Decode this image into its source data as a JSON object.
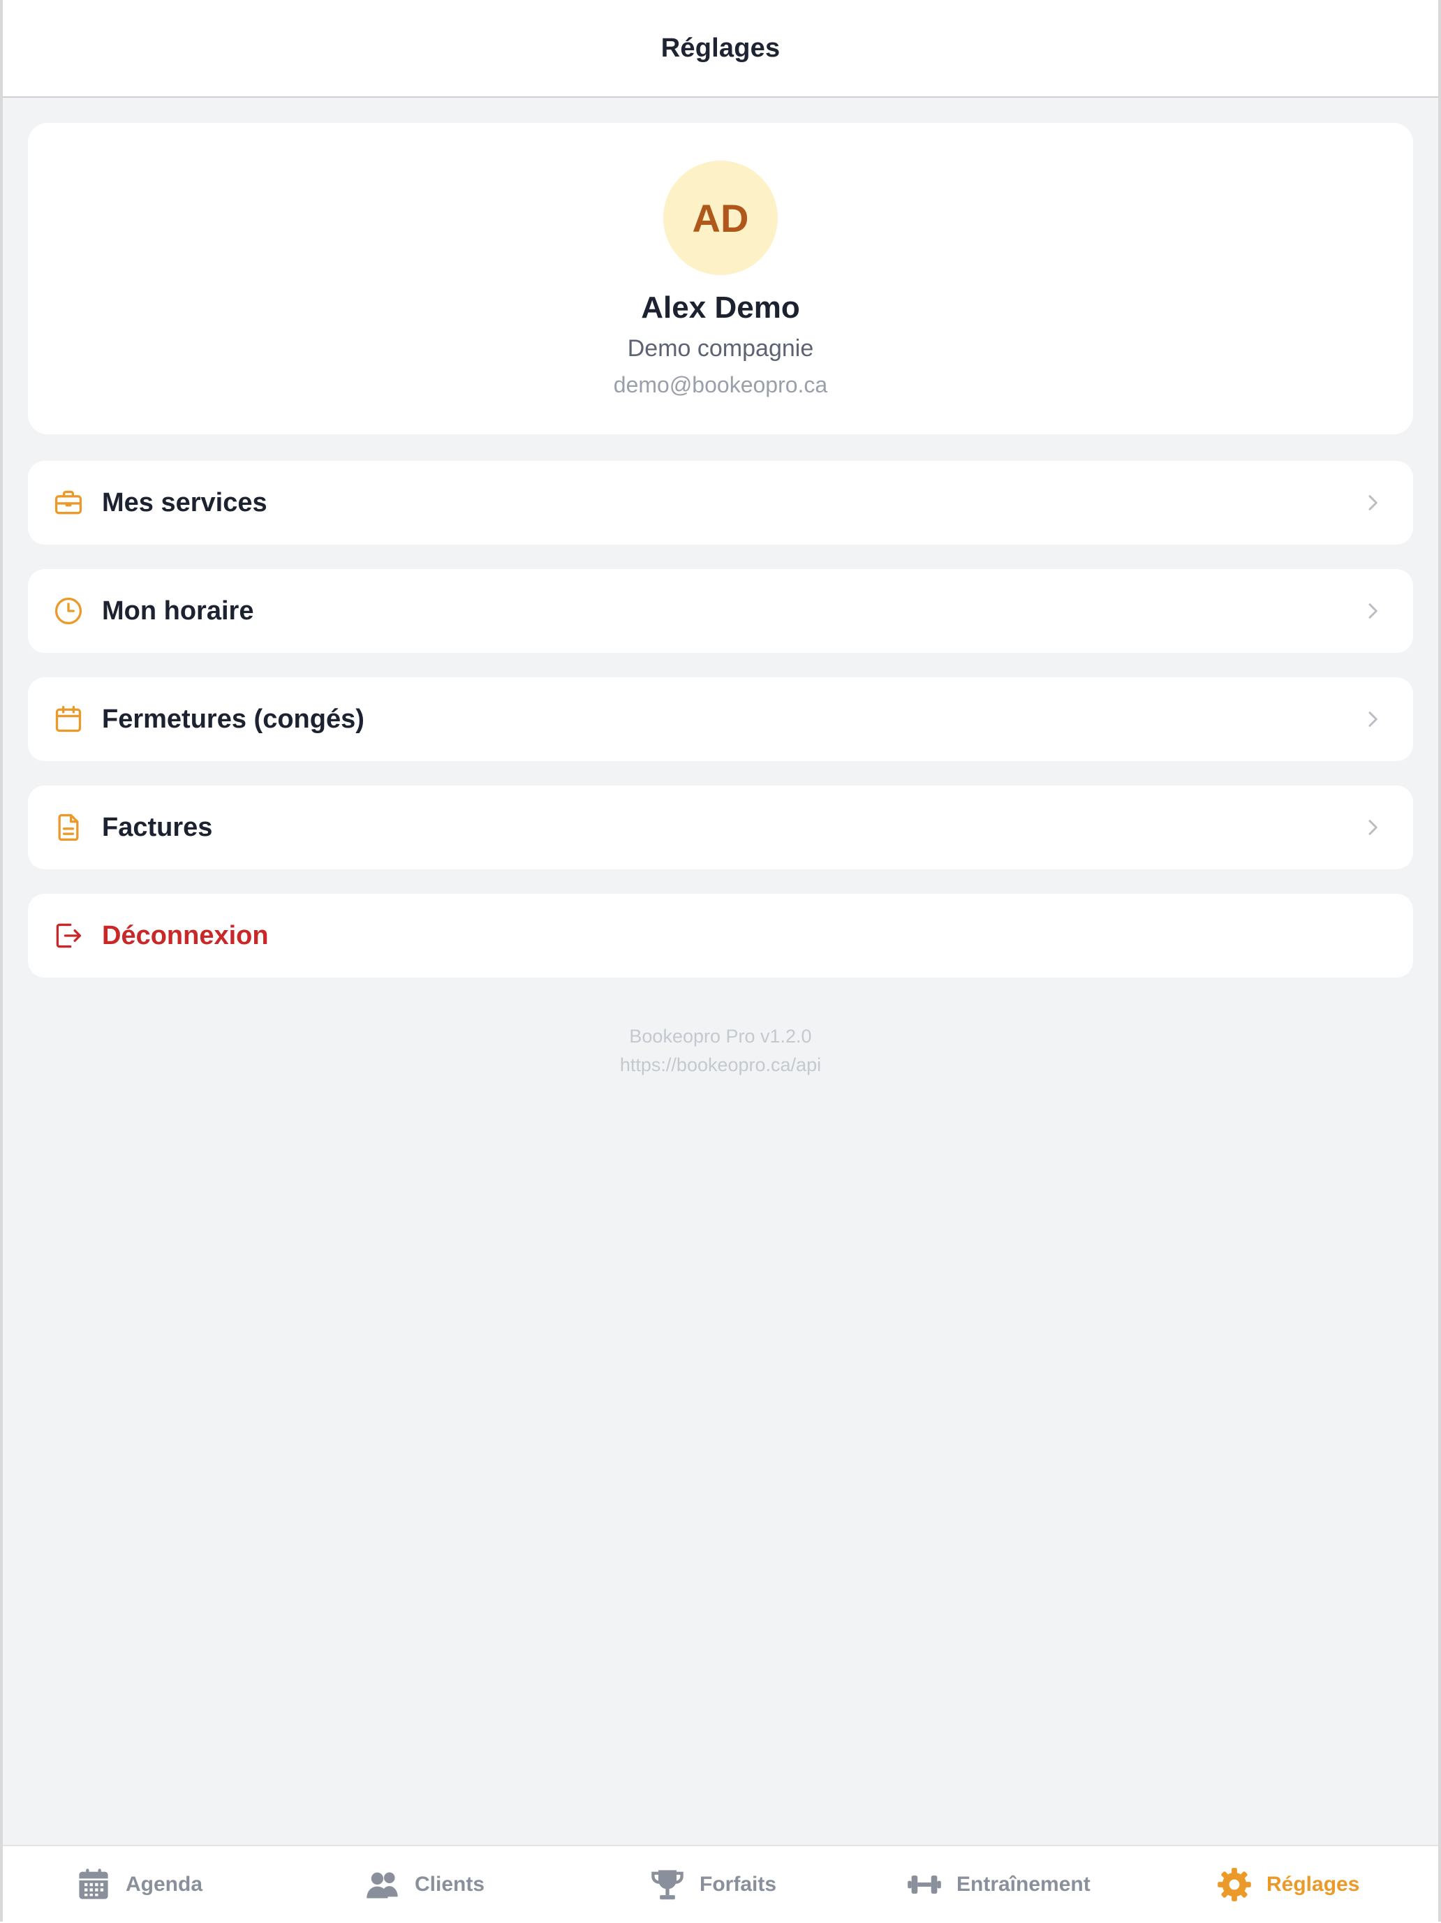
{
  "header": {
    "title": "Réglages"
  },
  "profile": {
    "initials": "AD",
    "name": "Alex Demo",
    "company": "Demo compagnie",
    "email": "demo@bookeopro.ca"
  },
  "menu": {
    "services": {
      "label": "Mes services",
      "icon": "briefcase-icon"
    },
    "schedule": {
      "label": "Mon horaire",
      "icon": "clock-icon"
    },
    "closures": {
      "label": "Fermetures (congés)",
      "icon": "calendar-icon"
    },
    "invoices": {
      "label": "Factures",
      "icon": "document-icon"
    },
    "logout": {
      "label": "Déconnexion",
      "icon": "logout-icon"
    }
  },
  "footer": {
    "version": "Bookeopro Pro v1.2.0",
    "api_url": "https://bookeopro.ca/api"
  },
  "tabs": [
    {
      "label": "Agenda",
      "icon": "calendar-grid-icon",
      "active": false
    },
    {
      "label": "Clients",
      "icon": "users-icon",
      "active": false
    },
    {
      "label": "Forfaits",
      "icon": "trophy-icon",
      "active": false
    },
    {
      "label": "Entraînement",
      "icon": "dumbbell-icon",
      "active": false
    },
    {
      "label": "Réglages",
      "icon": "gear-icon",
      "active": true
    }
  ],
  "colors": {
    "accent": "#eb9a2a",
    "danger": "#c82828",
    "avatar_bg": "#fdf1c7",
    "avatar_text": "#b0581c",
    "background": "#f2f3f5"
  }
}
